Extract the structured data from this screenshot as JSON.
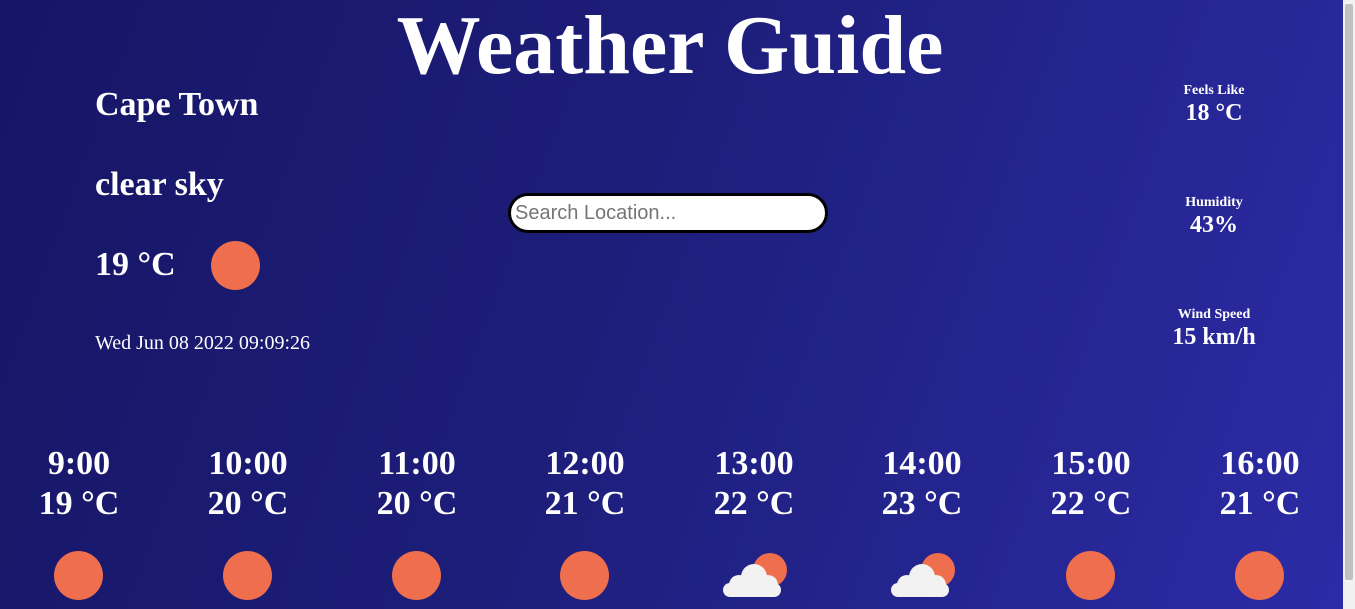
{
  "app": {
    "title": "Weather Guide"
  },
  "current": {
    "city": "Cape Town",
    "description": "clear sky",
    "temperature": "19 °C",
    "datetime": "Wed Jun 08 2022 09:09:26",
    "icon": "sun-icon"
  },
  "search": {
    "placeholder": "Search Location...",
    "value": ""
  },
  "stats": {
    "feels_like": {
      "label": "Feels Like",
      "value": "18 °C"
    },
    "humidity": {
      "label": "Humidity",
      "value": "43%"
    },
    "wind_speed": {
      "label": "Wind Speed",
      "value": "15 km/h"
    }
  },
  "hourly": [
    {
      "time": "9:00",
      "temp": "19 °C",
      "icon": "sun-icon"
    },
    {
      "time": "10:00",
      "temp": "20 °C",
      "icon": "sun-icon"
    },
    {
      "time": "11:00",
      "temp": "20 °C",
      "icon": "sun-icon"
    },
    {
      "time": "12:00",
      "temp": "21 °C",
      "icon": "sun-icon"
    },
    {
      "time": "13:00",
      "temp": "22 °C",
      "icon": "partly-cloudy-icon"
    },
    {
      "time": "14:00",
      "temp": "23 °C",
      "icon": "partly-cloudy-icon"
    },
    {
      "time": "15:00",
      "temp": "22 °C",
      "icon": "sun-icon"
    },
    {
      "time": "16:00",
      "temp": "21 °C",
      "icon": "sun-icon"
    }
  ],
  "colors": {
    "sun": "#ee6e4d",
    "cloud": "#f2f2f2",
    "background_start": "#161565",
    "background_end": "#2c2ba6"
  }
}
